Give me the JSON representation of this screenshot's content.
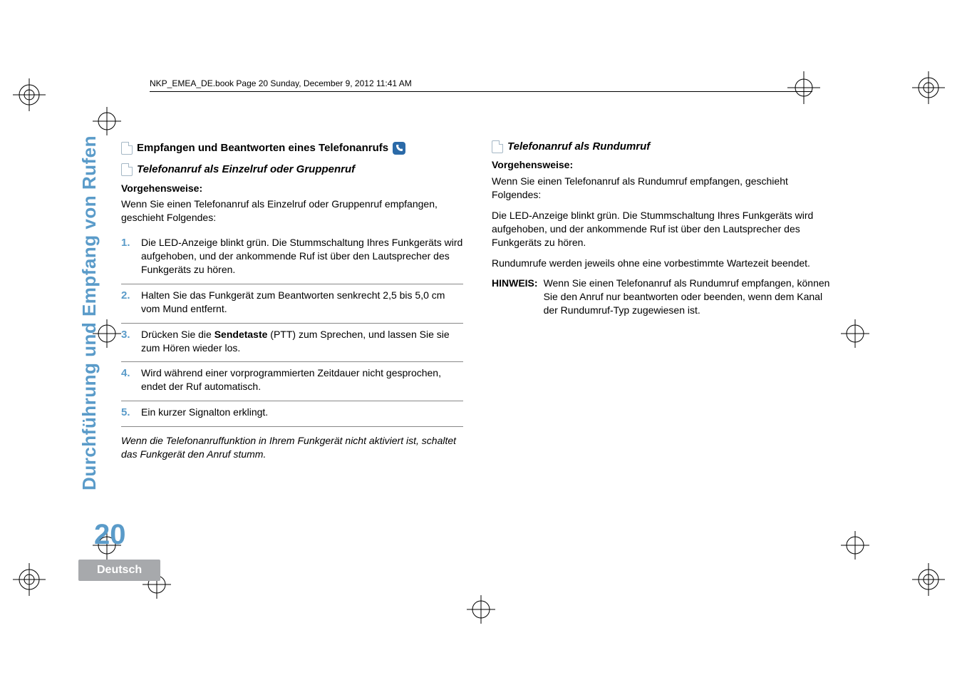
{
  "header": {
    "running_head": "NKP_EMEA_DE.book  Page 20  Sunday, December 9, 2012  11:41 AM"
  },
  "side": {
    "section_title": "Durchführung und Empfang von Rufen"
  },
  "page": {
    "number": "20",
    "language": "Deutsch"
  },
  "left": {
    "section_heading": "Empfangen und Beantworten eines Telefonanrufs",
    "sub_heading": "Telefonanruf als Einzelruf oder Gruppenruf",
    "proc_label": "Vorgehensweise:",
    "intro": "Wenn Sie einen Telefonanruf als Einzelruf oder Gruppenruf empfangen, geschieht Folgendes:",
    "steps": [
      "Die LED-Anzeige blinkt grün. Die Stummschaltung Ihres Funkgeräts wird aufgehoben, und der ankommende Ruf ist über den Lautsprecher des Funkgeräts zu hören.",
      "Halten Sie das Funkgerät zum Beantworten senkrecht 2,5 bis 5,0 cm vom Mund entfernt.",
      "Drücken Sie die |Sendetaste| (PTT) zum Sprechen, und lassen Sie sie zum Hören wieder los.",
      "Wird während einer vorprogrammierten Zeitdauer nicht gesprochen, endet der Ruf automatisch.",
      "Ein kurzer Signalton erklingt."
    ],
    "footnote": "Wenn die Telefonanruffunktion in Ihrem Funkgerät nicht aktiviert ist, schaltet das Funkgerät den Anruf stumm."
  },
  "right": {
    "sub_heading": "Telefonanruf als Rundumruf",
    "proc_label": "Vorgehensweise:",
    "intro": "Wenn Sie einen Telefonanruf als Rundumruf empfangen, geschieht Folgendes:",
    "para1": "Die LED-Anzeige blinkt grün. Die Stummschaltung Ihres Funkgeräts wird aufgehoben, und der ankommende Ruf ist über den Lautsprecher des Funkgeräts zu hören.",
    "para2": "Rundumrufe werden jeweils ohne eine vorbestimmte Wartezeit beendet.",
    "note_label": "HINWEIS:",
    "note_text": "Wenn Sie einen Telefonanruf als Rundumruf empfangen, können Sie den Anruf nur beantworten oder beenden, wenn dem Kanal der Rundumruf-Typ zugewiesen ist."
  }
}
